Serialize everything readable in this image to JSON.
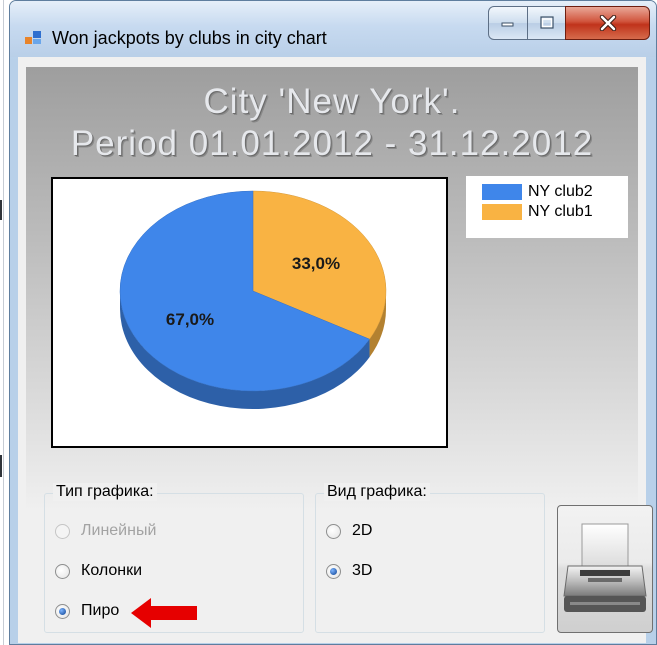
{
  "window": {
    "title": "Won jackpots by clubs in city chart"
  },
  "chart": {
    "title_line1": "City 'New York'.",
    "title_line2": "Period  01.01.2012  - 31.12.2012"
  },
  "chart_data": {
    "type": "pie",
    "title": "City 'New York'. Period 01.01.2012 - 31.12.2012",
    "categories": [
      "NY club2",
      "NY club1"
    ],
    "values": [
      67.0,
      33.0
    ],
    "data_labels": [
      "67,0%",
      "33,0%"
    ],
    "colors": [
      "#3f86ea",
      "#f9b343"
    ],
    "style": "3D",
    "legend_position": "right-top"
  },
  "legend": {
    "items": [
      {
        "label": "NY club2",
        "color": "#3f86ea"
      },
      {
        "label": "NY club1",
        "color": "#f9b343"
      }
    ]
  },
  "chart_type_group": {
    "title": "Тип графика:",
    "options": [
      {
        "label": "Линейный",
        "checked": false,
        "disabled": true
      },
      {
        "label": "Колонки",
        "checked": false,
        "disabled": false
      },
      {
        "label": "Пиро",
        "checked": true,
        "disabled": false
      }
    ]
  },
  "view_group": {
    "title": "Вид графика:",
    "options": [
      {
        "label": "2D",
        "checked": false
      },
      {
        "label": "3D",
        "checked": true
      }
    ]
  },
  "icons": {
    "app": "app-icon",
    "minimize": "minimize-icon",
    "maximize": "maximize-icon",
    "close": "close-icon",
    "print": "printer-icon",
    "annotation": "red-arrow-icon"
  }
}
